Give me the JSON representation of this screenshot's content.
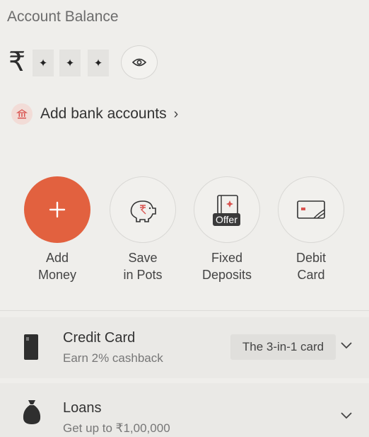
{
  "header": {
    "title": "Account Balance"
  },
  "balance": {
    "currency_symbol": "₹",
    "masked": [
      "✦",
      "✦",
      "✦"
    ],
    "toggle_icon": "eye-icon"
  },
  "bank": {
    "label": "Add bank accounts",
    "chevron": "›",
    "icon": "bank-icon"
  },
  "actions": [
    {
      "label": "Add\nMoney",
      "icon": "plus-icon"
    },
    {
      "label": "Save\nin Pots",
      "icon": "piggy-bank-icon"
    },
    {
      "label": "Fixed\nDeposits",
      "icon": "fixed-deposit-icon",
      "badge": "Offer"
    },
    {
      "label": "Debit\nCard",
      "icon": "card-icon"
    }
  ],
  "products": {
    "credit_card": {
      "title": "Credit Card",
      "subtitle": "Earn 2% cashback",
      "pill": "The 3-in-1 card",
      "icon": "credit-card-icon"
    },
    "loans": {
      "title": "Loans",
      "subtitle": "Get up to ₹1,00,000",
      "icon": "money-bag-icon"
    }
  },
  "colors": {
    "accent": "#e2613f",
    "background": "#efeeeb"
  }
}
